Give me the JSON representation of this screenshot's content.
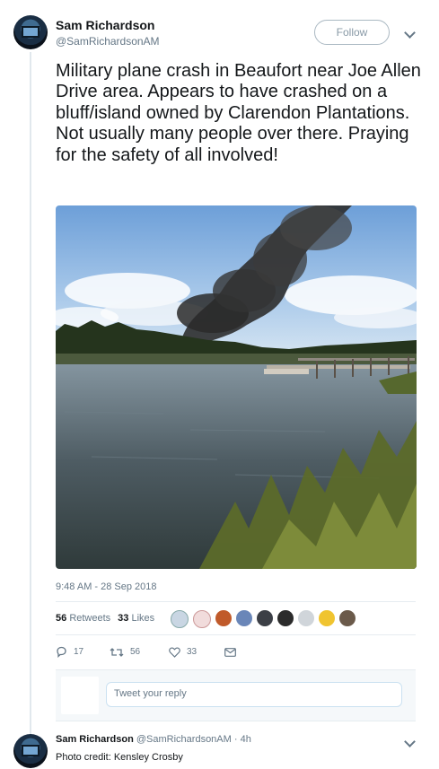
{
  "tweet": {
    "author_name": "Sam Richardson",
    "author_handle": "@SamRichardsonAM",
    "follow_label": "Follow",
    "text": "Military plane crash in Beaufort near Joe Allen Drive area. Appears to have crashed on a bluff/island owned by Clarendon Plantations. Not usually many people over there. Praying for the safety of all involved!",
    "timestamp": "9:48 AM - 28 Sep 2018",
    "retweets_count": "56",
    "retweets_label": "Retweets",
    "likes_count": "33",
    "likes_label": "Likes"
  },
  "actions": {
    "reply_count": "17",
    "retweet_count": "56",
    "like_count": "33"
  },
  "reply_box": {
    "placeholder": "Tweet your reply"
  },
  "reply": {
    "author_name": "Sam Richardson",
    "author_handle": "@SamRichardsonAM",
    "time": "· 4h",
    "text": "Photo credit: Kensley Crosby"
  },
  "icons": {
    "reply": "reply-icon",
    "retweet": "retweet-icon",
    "like": "heart-icon",
    "message": "envelope-icon",
    "more": "chevron-down-icon"
  },
  "colors": {
    "text": "#14171a",
    "secondary": "#657786",
    "border": "#e6ecf0",
    "reply_bg": "#f5f8fa"
  }
}
